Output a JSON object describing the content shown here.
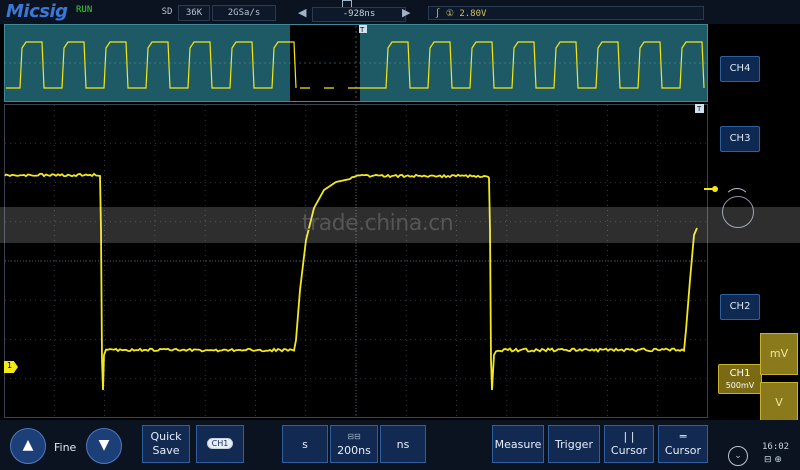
{
  "header": {
    "brand": "Micsig",
    "run_state": "RUN",
    "acq_mode": "SD",
    "memory_depth": "36K",
    "sample_rate": "2GSa/s",
    "horizontal_offset": "-928ns",
    "trigger_source": "①",
    "trigger_level": "2.80V"
  },
  "channels": {
    "ch4_label": "CH4",
    "ch3_label": "CH3",
    "ch2_label": "CH2",
    "ch1_label": "CH1",
    "ch1_scale": "500mV",
    "ch1_marker": "1",
    "unit_up": "mV",
    "unit_down": "V"
  },
  "watermark": "trade.china.cn",
  "toolbar": {
    "fine_label": "Fine",
    "quick_save_line1": "Quick",
    "quick_save_line2": "Save",
    "ch1_chip": "CH1",
    "timebase_s": "s",
    "timebase_value": "200ns",
    "timebase_ns": "ns",
    "measure": "Measure",
    "trigger": "Trigger",
    "cursor_v": "Cursor",
    "cursor_h": "Cursor",
    "time": "16:02"
  },
  "colors": {
    "ch1_trace": "#f2e81a",
    "accent_blue": "#2e5fa0",
    "overview_bg": "#1e5a66"
  },
  "icons": [
    "up-arrow-icon",
    "down-arrow-icon",
    "chevron-down-icon",
    "usb-icon",
    "trigger-edge-icon",
    "left-triangle-icon",
    "right-triangle-icon"
  ]
}
